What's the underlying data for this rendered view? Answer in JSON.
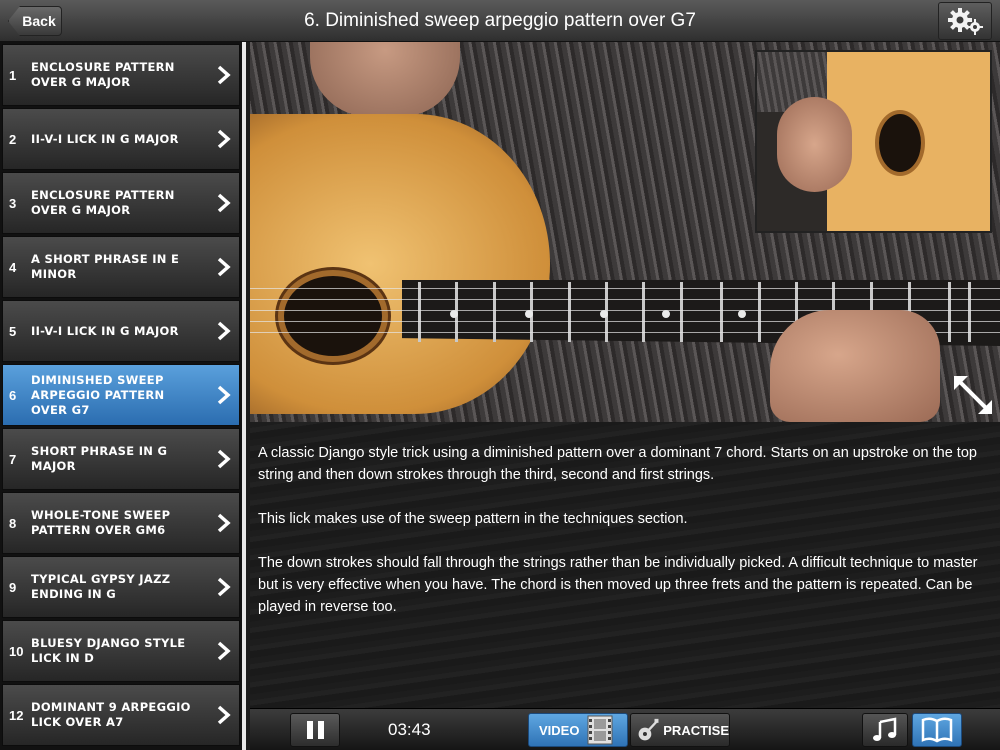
{
  "header": {
    "back_label": "Back",
    "title": "6. Diminished sweep arpeggio pattern over G7",
    "settings_icon": "gear-icon"
  },
  "lessons": [
    {
      "num": "1",
      "title": "Enclosure pattern over G major"
    },
    {
      "num": "2",
      "title": "II-V-I lick in G major"
    },
    {
      "num": "3",
      "title": "Enclosure pattern over G major"
    },
    {
      "num": "4",
      "title": "A short phrase in E minor"
    },
    {
      "num": "5",
      "title": "II-V-I lick in G major"
    },
    {
      "num": "6",
      "title": "Diminished sweep arpeggio pattern over G7"
    },
    {
      "num": "7",
      "title": "Short phrase in G major"
    },
    {
      "num": "8",
      "title": "Whole-tone sweep pattern over Gm6"
    },
    {
      "num": "9",
      "title": "Typical gypsy jazz ending in G"
    },
    {
      "num": "10",
      "title": "Bluesy Django style lick in D"
    },
    {
      "num": "12",
      "title": "Dominant 9 arpeggio lick over A7"
    }
  ],
  "active_lesson": "6",
  "description": {
    "p1": "A classic Django style trick using a diminished pattern over a dominant 7 chord. Starts on an upstroke on the top string and then down strokes through the third, second and first strings.",
    "p2": "This lick makes use of the sweep pattern in the techniques section.",
    "p3": "The down strokes should fall through the strings rather than be individually picked. A difficult technique to master but is very effective when you have. The chord is then moved up three frets and the pattern is repeated. Can be played in reverse too."
  },
  "player": {
    "time": "03:43",
    "video_label": "VIDEO",
    "practise_label": "PRACTISE"
  },
  "colors": {
    "accent": "#3b86c8",
    "bar": "#2e2e2e"
  }
}
